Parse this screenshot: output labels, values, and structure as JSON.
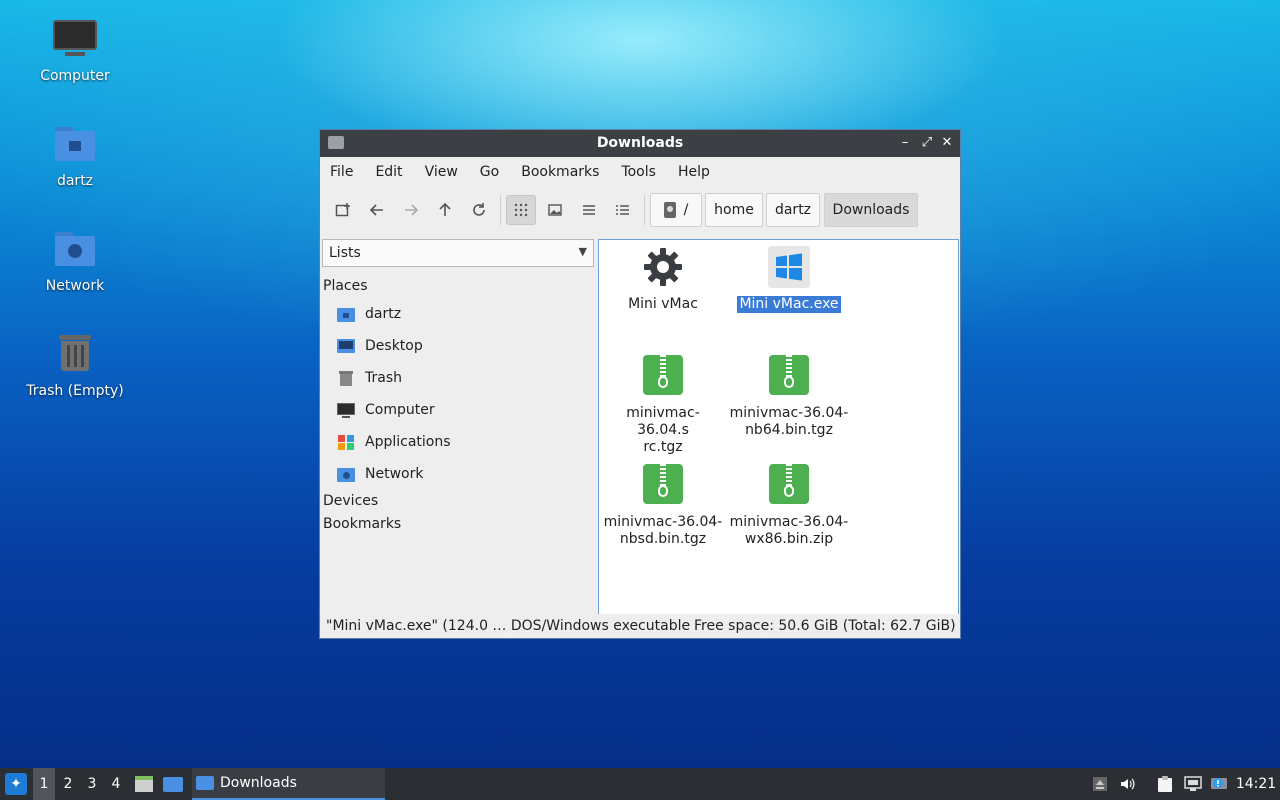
{
  "desktop": {
    "icons": [
      {
        "label": "Computer"
      },
      {
        "label": "dartz"
      },
      {
        "label": "Network"
      },
      {
        "label": "Trash (Empty)"
      }
    ]
  },
  "window": {
    "title": "Downloads",
    "controls": {
      "minimize": "–",
      "maximize": "⤢",
      "close": "✕"
    },
    "menu": [
      "File",
      "Edit",
      "View",
      "Go",
      "Bookmarks",
      "Tools",
      "Help"
    ],
    "toolbar": {
      "buttons": [
        "new-tab-icon",
        "back-icon",
        "forward-icon",
        "up-icon",
        "reload-icon",
        "icon-view-icon",
        "thumbnail-view-icon",
        "compact-view-icon",
        "detailed-view-icon"
      ]
    },
    "breadcrumb": [
      "/",
      "home",
      "dartz",
      "Downloads"
    ],
    "sidebar": {
      "mode": "Lists",
      "places_header": "Places",
      "places": [
        {
          "label": "dartz",
          "icon": "home-folder-icon"
        },
        {
          "label": "Desktop",
          "icon": "desktop-icon"
        },
        {
          "label": "Trash",
          "icon": "trash-icon"
        },
        {
          "label": "Computer",
          "icon": "computer-icon"
        },
        {
          "label": "Applications",
          "icon": "applications-icon"
        },
        {
          "label": "Network",
          "icon": "network-folder-icon"
        }
      ],
      "devices_header": "Devices",
      "bookmarks_header": "Bookmarks"
    },
    "files": [
      {
        "name": "Mini vMac",
        "icon": "gear-icon",
        "selected": false
      },
      {
        "name": "Mini vMac.exe",
        "icon": "windows-exe-icon",
        "selected": true
      },
      {
        "name": "minivmac-36.04.s\nrc.tgz",
        "line1": "minivmac-36.04.s",
        "line2": "rc.tgz",
        "icon": "archive-icon"
      },
      {
        "name": "minivmac-36.04-nb64.bin.tgz",
        "line1": "minivmac-36.04-",
        "line2": "nb64.bin.tgz",
        "icon": "archive-icon"
      },
      {
        "name": "minivmac-36.04-nbsd.bin.tgz",
        "line1": "minivmac-36.04-",
        "line2": "nbsd.bin.tgz",
        "icon": "archive-icon"
      },
      {
        "name": "minivmac-36.04-wx86.bin.zip",
        "line1": "minivmac-36.04-",
        "line2": "wx86.bin.zip",
        "icon": "archive-icon"
      }
    ],
    "status": {
      "selection": "\"Mini vMac.exe\" (124.0 … DOS/Windows executable",
      "free_space": "Free space: 50.6 GiB (Total: 62.7 GiB)"
    }
  },
  "taskbar": {
    "workspaces": [
      "1",
      "2",
      "3",
      "4"
    ],
    "task_label": "Downloads",
    "clock": "14:21"
  }
}
